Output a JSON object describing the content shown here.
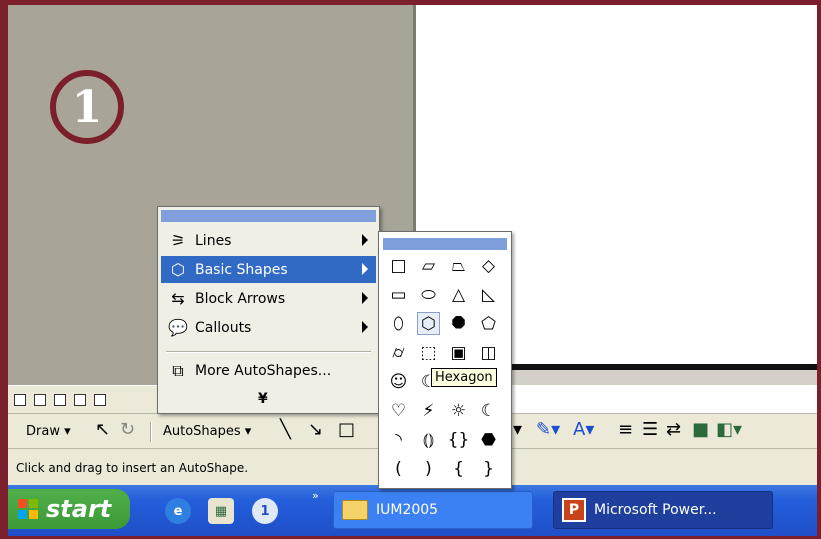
{
  "step_badge": "1",
  "autoshapes_menu": {
    "items": [
      {
        "label": "Lines",
        "icon": "lines-icon",
        "glyph": "⚞",
        "submenu": true
      },
      {
        "label": "Basic Shapes",
        "icon": "basic-shapes-icon",
        "glyph": "⬡",
        "submenu": true,
        "highlighted": true
      },
      {
        "label": "Block Arrows",
        "icon": "block-arrows-icon",
        "glyph": "⇆",
        "submenu": true
      },
      {
        "label": "Callouts",
        "icon": "callouts-icon",
        "glyph": "💬",
        "submenu": true
      },
      {
        "label": "More AutoShapes...",
        "icon": "more-autoshapes-icon",
        "glyph": "⧉",
        "submenu": false
      }
    ],
    "expand_glyph": "¥"
  },
  "basic_shapes": {
    "rows": [
      [
        "□",
        "▱",
        "⏢",
        "◇"
      ],
      [
        "▭",
        "⬭",
        "△",
        "◺"
      ],
      [
        "⬯",
        "⬡",
        "⯃",
        "⬠"
      ],
      [
        "⌭",
        "⬚",
        "▣",
        "◫"
      ],
      [
        "☺",
        "☾",
        "",
        ""
      ],
      [
        "♡",
        "⚡",
        "☼",
        "☾"
      ],
      [
        "◝",
        "⦅⦆",
        "{}",
        "⬣"
      ],
      [
        "(",
        ")",
        "{",
        "}"
      ]
    ],
    "tooltip": "Hexagon"
  },
  "drawing_toolbar": {
    "draw_label": "Draw",
    "autoshapes_label": "AutoShapes",
    "right_tools": [
      "▾",
      "✎▾",
      "A▾",
      "≡",
      "☰",
      "⇄",
      "■",
      "◧▾"
    ]
  },
  "status_text": "Click and drag to insert an AutoShape.",
  "taskbar": {
    "start_label": "start",
    "folder_label": "IUM2005",
    "ppt_label": "Microsoft Power...",
    "ppt_icon_letter": "P",
    "quick_launch_more": "»"
  },
  "colors": {
    "frame": "#7a1f2b",
    "menu_highlight": "#316ac5",
    "menu_title": "#7e9fdc",
    "taskbar": "#245edb",
    "start_button": "#3c9a36"
  }
}
